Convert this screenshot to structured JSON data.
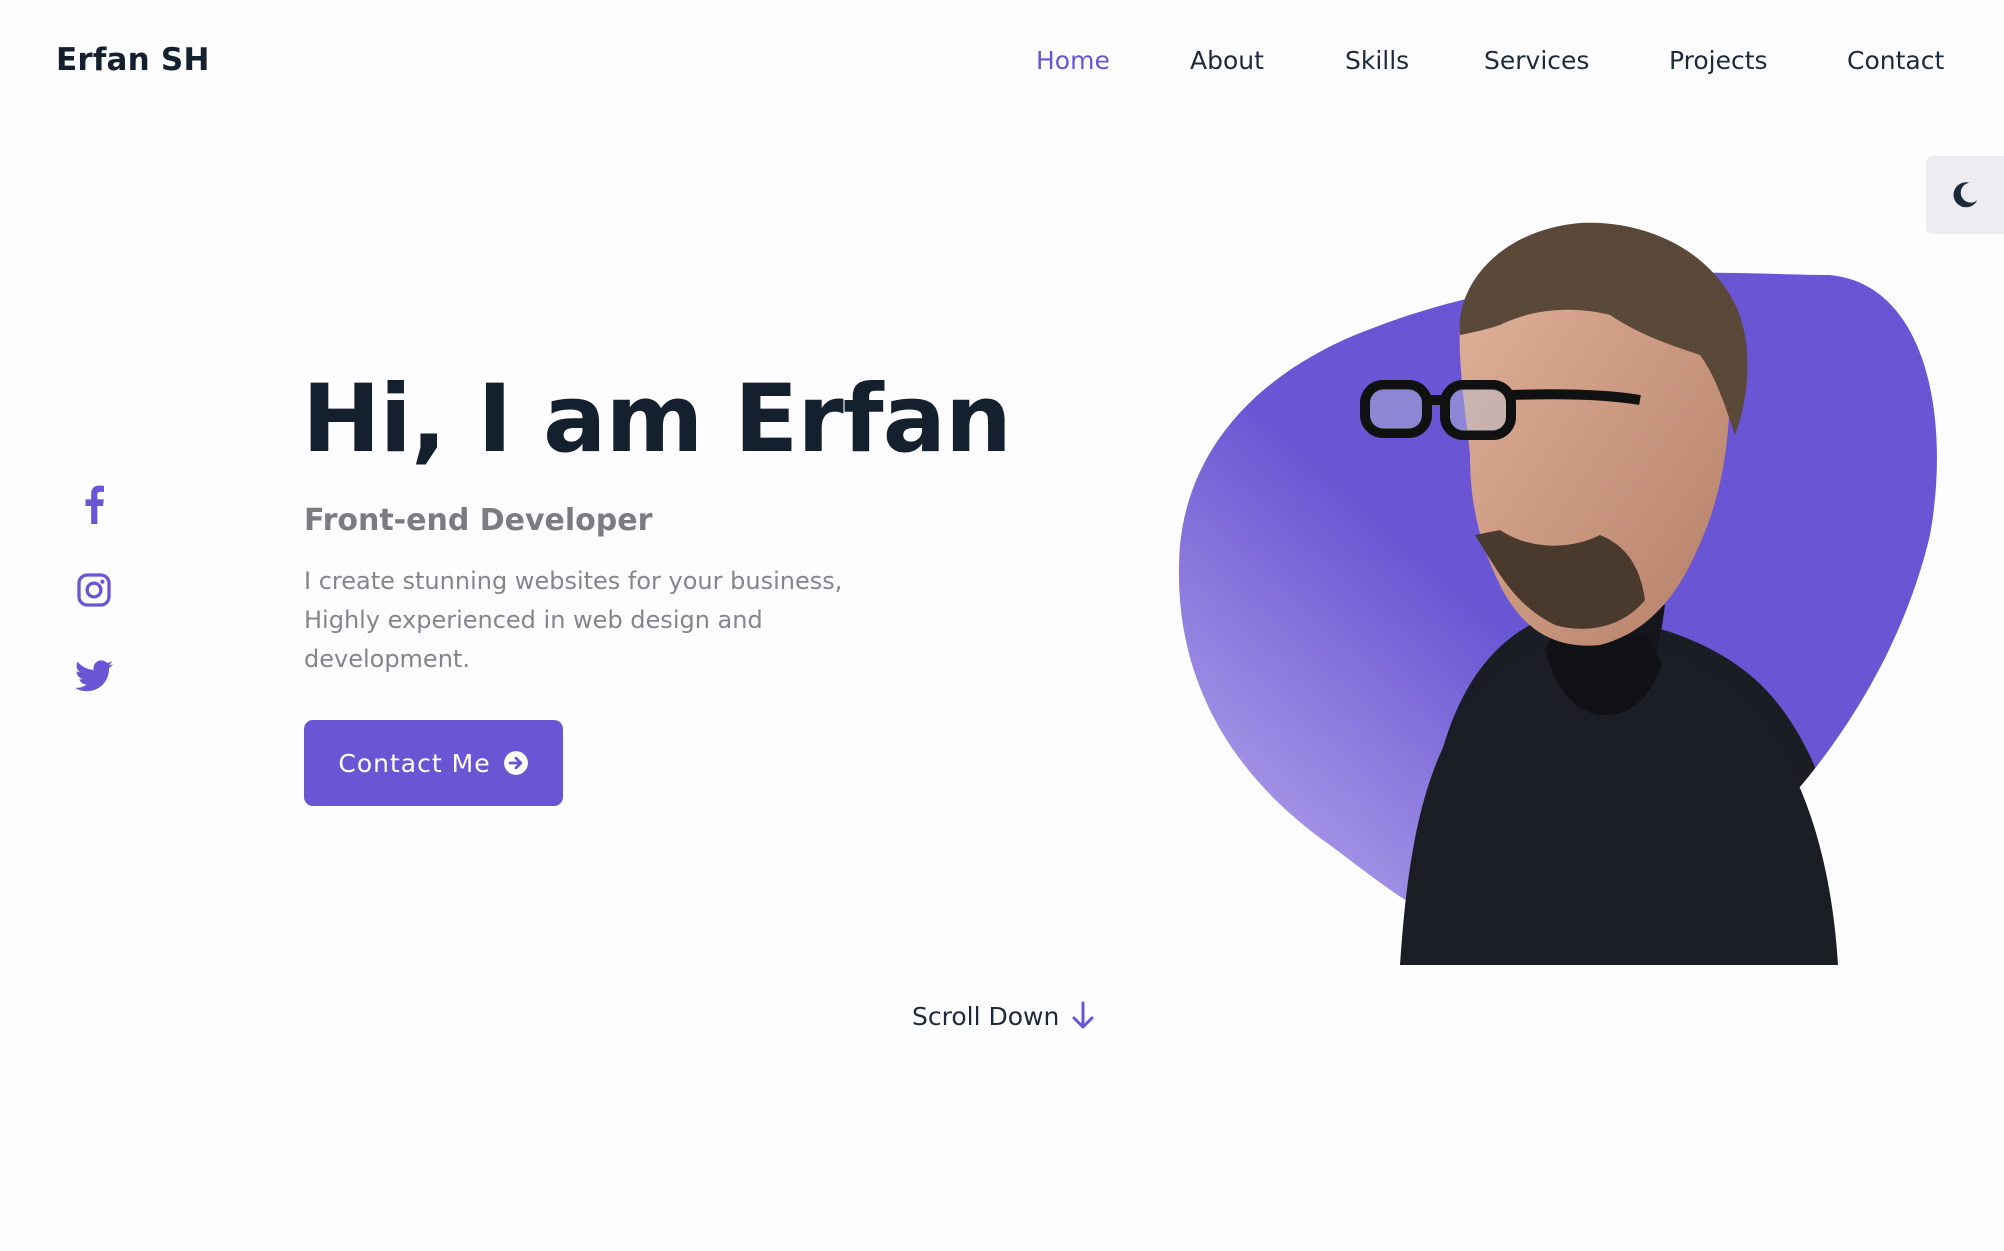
{
  "brand": "Erfan SH",
  "nav": {
    "items": [
      {
        "label": "Home",
        "active": true
      },
      {
        "label": "About",
        "active": false
      },
      {
        "label": "Skills",
        "active": false
      },
      {
        "label": "Services",
        "active": false
      },
      {
        "label": "Projects",
        "active": false
      },
      {
        "label": "Contact",
        "active": false
      }
    ]
  },
  "theme_toggle": {
    "icon": "moon-icon"
  },
  "social": [
    {
      "icon": "facebook-icon"
    },
    {
      "icon": "instagram-icon"
    },
    {
      "icon": "twitter-icon"
    }
  ],
  "hero": {
    "title": "Hi, I am Erfan",
    "subtitle": "Front-end Developer",
    "description": "I create stunning websites for your business, Highly experienced in web design and development.",
    "cta_label": "Contact Me",
    "cta_icon": "arrow-right-circle-icon"
  },
  "scroll_down": {
    "label": "Scroll Down",
    "icon": "arrow-down-icon"
  },
  "portrait": {
    "icon": "profile-portrait"
  },
  "colors": {
    "accent": "#6a56d4",
    "text_dark": "#14202e",
    "text_muted": "#85858a",
    "background": "#fdfcfe"
  }
}
